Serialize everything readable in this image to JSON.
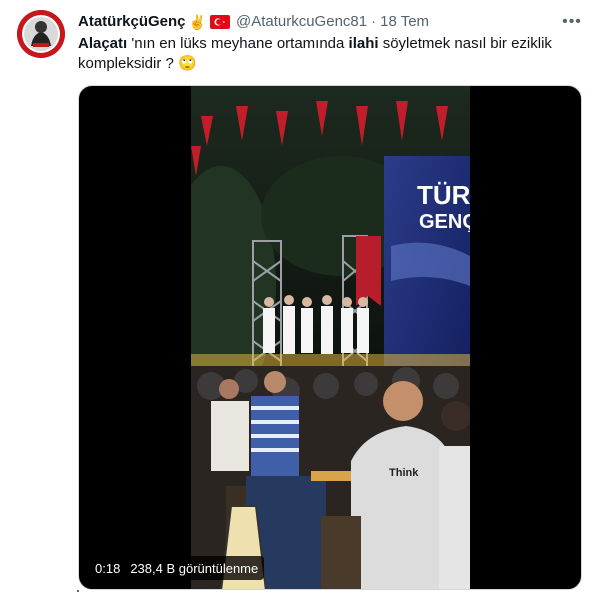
{
  "tweet": {
    "display_name": "AtatürkçüGenç",
    "name_emoji": "✌",
    "handle": "@AtaturkcuGenc81",
    "separator": "·",
    "time": "18 Tem",
    "more_label": "•••",
    "text_parts": {
      "p1": "Alaçatı",
      "p2": " 'nın en lüks meyhane ortamında ",
      "p3": "ilahi",
      "p4": " söyletmek nasıl bir eziklik kompleksidir ? ",
      "emoji": "🙄"
    }
  },
  "video": {
    "duration": "0:18",
    "views": "238,4 B görüntülenme",
    "screen_text_1": "TÜRK",
    "screen_text_2": "GENÇ",
    "shirt_text": "Think"
  },
  "colors": {
    "text_primary": "#0f1419",
    "text_secondary": "#536471",
    "avatar_red": "#c8161d",
    "flag_red": "#e30a17"
  }
}
